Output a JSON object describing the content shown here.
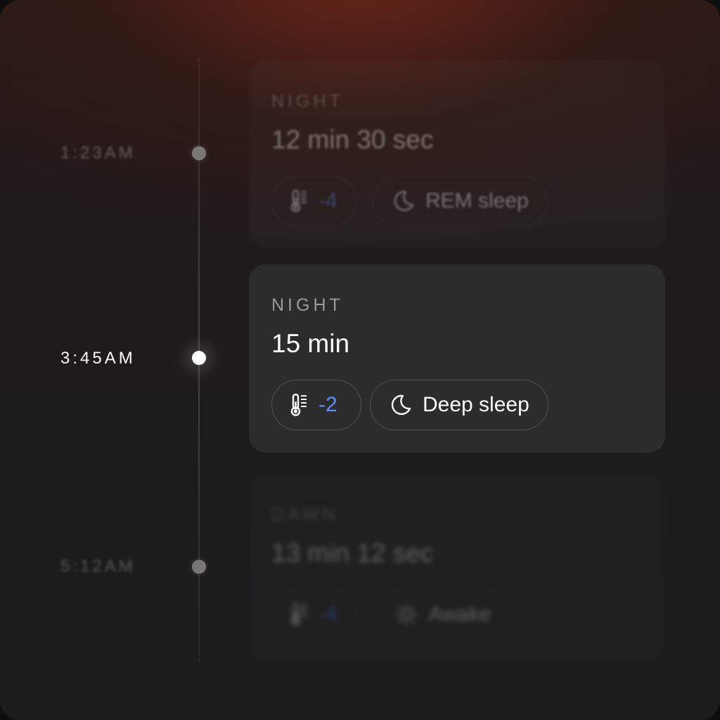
{
  "colors": {
    "accent_temp": "#5b8cff",
    "text_primary": "#ffffff",
    "text_label": "#9c9a98",
    "card_active": "#2c2c2d"
  },
  "entries": [
    {
      "time": "1:23AM",
      "period": "NIGHT",
      "duration": "12 min 30 sec",
      "temp_icon": "thermometer-icon",
      "temp_value": "-4",
      "stage_icon": "moon-icon",
      "stage": "REM sleep",
      "state": "past"
    },
    {
      "time": "3:45AM",
      "period": "NIGHT",
      "duration": "15 min",
      "temp_icon": "thermometer-icon",
      "temp_value": "-2",
      "stage_icon": "moon-icon",
      "stage": "Deep sleep",
      "state": "active"
    },
    {
      "time": "5:12AM",
      "period": "DAWN",
      "duration": "13 min 12 sec",
      "temp_icon": "thermometer-icon",
      "temp_value": "-4",
      "stage_icon": "sun-icon",
      "stage": "Awake",
      "state": "upcoming"
    }
  ]
}
